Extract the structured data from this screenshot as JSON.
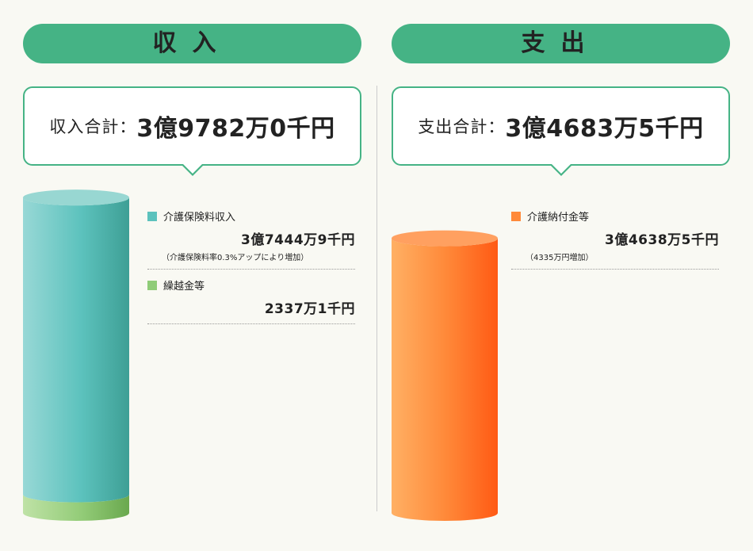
{
  "income": {
    "header": "収入",
    "total_label": "収入合計：",
    "total_value": "3億9782万0千円"
  },
  "expense": {
    "header": "支出",
    "total_label": "支出合計：",
    "total_value": "3億4683万5千円"
  },
  "legend": {
    "income": [
      {
        "name": "介護保険料収入",
        "amount": "3億7444万9千円",
        "note": "（介護保険料率0.3%アップにより増加）",
        "color": "#5cc2bd"
      },
      {
        "name": "繰越金等",
        "amount": "2337万1千円",
        "color": "#8fcc78"
      }
    ],
    "expense": [
      {
        "name": "介護納付金等",
        "amount": "3億4638万5千円",
        "note": "（4335万円増加）",
        "color": "#ff8a3a"
      }
    ]
  },
  "chart_data": [
    {
      "type": "bar",
      "title": "収入",
      "categories": [
        "介護保険料収入",
        "繰越金等"
      ],
      "values": [
        374449,
        23371
      ],
      "unit": "千円",
      "stacked": true
    },
    {
      "type": "bar",
      "title": "支出",
      "categories": [
        "介護納付金等"
      ],
      "values": [
        346385
      ],
      "unit": "千円"
    }
  ]
}
